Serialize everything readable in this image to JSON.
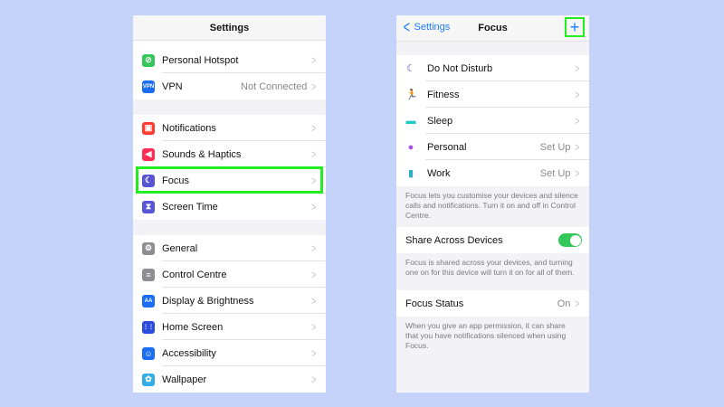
{
  "left": {
    "title": "Settings",
    "group1": [
      {
        "label": "Personal Hotspot",
        "value": "",
        "icon": "hotspot-icon",
        "color": "#34c759",
        "glyph": "⊘"
      },
      {
        "label": "VPN",
        "value": "Not Connected",
        "icon": "vpn-icon",
        "color": "#1b6ef3",
        "glyph": "VPN"
      }
    ],
    "group2": [
      {
        "label": "Notifications",
        "value": "",
        "icon": "notifications-icon",
        "color": "#ff3b30",
        "glyph": "▣"
      },
      {
        "label": "Sounds & Haptics",
        "value": "",
        "icon": "sounds-icon",
        "color": "#ff2d55",
        "glyph": "◀"
      },
      {
        "label": "Focus",
        "value": "",
        "icon": "moon-icon",
        "color": "#5856d6",
        "glyph": "☾"
      },
      {
        "label": "Screen Time",
        "value": "",
        "icon": "hourglass-icon",
        "color": "#5856d6",
        "glyph": "⧗"
      }
    ],
    "group3": [
      {
        "label": "General",
        "value": "",
        "icon": "gear-icon",
        "color": "#8e8e93",
        "glyph": "⚙"
      },
      {
        "label": "Control Centre",
        "value": "",
        "icon": "control-centre-icon",
        "color": "#8e8e93",
        "glyph": "≡"
      },
      {
        "label": "Display & Brightness",
        "value": "",
        "icon": "display-icon",
        "color": "#1b6ef3",
        "glyph": "AA"
      },
      {
        "label": "Home Screen",
        "value": "",
        "icon": "home-screen-icon",
        "color": "#2c4ddb",
        "glyph": "⋮⋮"
      },
      {
        "label": "Accessibility",
        "value": "",
        "icon": "accessibility-icon",
        "color": "#1b6ef3",
        "glyph": "☺"
      },
      {
        "label": "Wallpaper",
        "value": "",
        "icon": "wallpaper-icon",
        "color": "#32ade6",
        "glyph": "✿"
      }
    ]
  },
  "right": {
    "back_label": "Settings",
    "title": "Focus",
    "plus_label": "+",
    "modes": [
      {
        "label": "Do Not Disturb",
        "value": "",
        "icon": "moon-icon",
        "color": "#5856d6",
        "glyph": "☾"
      },
      {
        "label": "Fitness",
        "value": "",
        "icon": "running-icon",
        "color": "#34c759",
        "glyph": "🏃"
      },
      {
        "label": "Sleep",
        "value": "",
        "icon": "bed-icon",
        "color": "#1fc8c8",
        "glyph": "▬"
      },
      {
        "label": "Personal",
        "value": "Set Up",
        "icon": "person-icon",
        "color": "#af52de",
        "glyph": "●"
      },
      {
        "label": "Work",
        "value": "Set Up",
        "icon": "work-badge-icon",
        "color": "#30b0c7",
        "glyph": "▮"
      }
    ],
    "modes_footnote": "Focus lets you customise your devices and silence calls and notifications. Turn it on and off in Control Centre.",
    "share_label": "Share Across Devices",
    "share_footnote": "Focus is shared across your devices, and turning one on for this device will turn it on for all of them.",
    "status_label": "Focus Status",
    "status_value": "On",
    "status_footnote": "When you give an app permission, it can share that you have notifications silenced when using Focus."
  },
  "colors": {
    "background": "#c5d3fb",
    "highlight": "#22ee22",
    "link": "#1b7cf5",
    "toggle_on": "#34c759"
  }
}
